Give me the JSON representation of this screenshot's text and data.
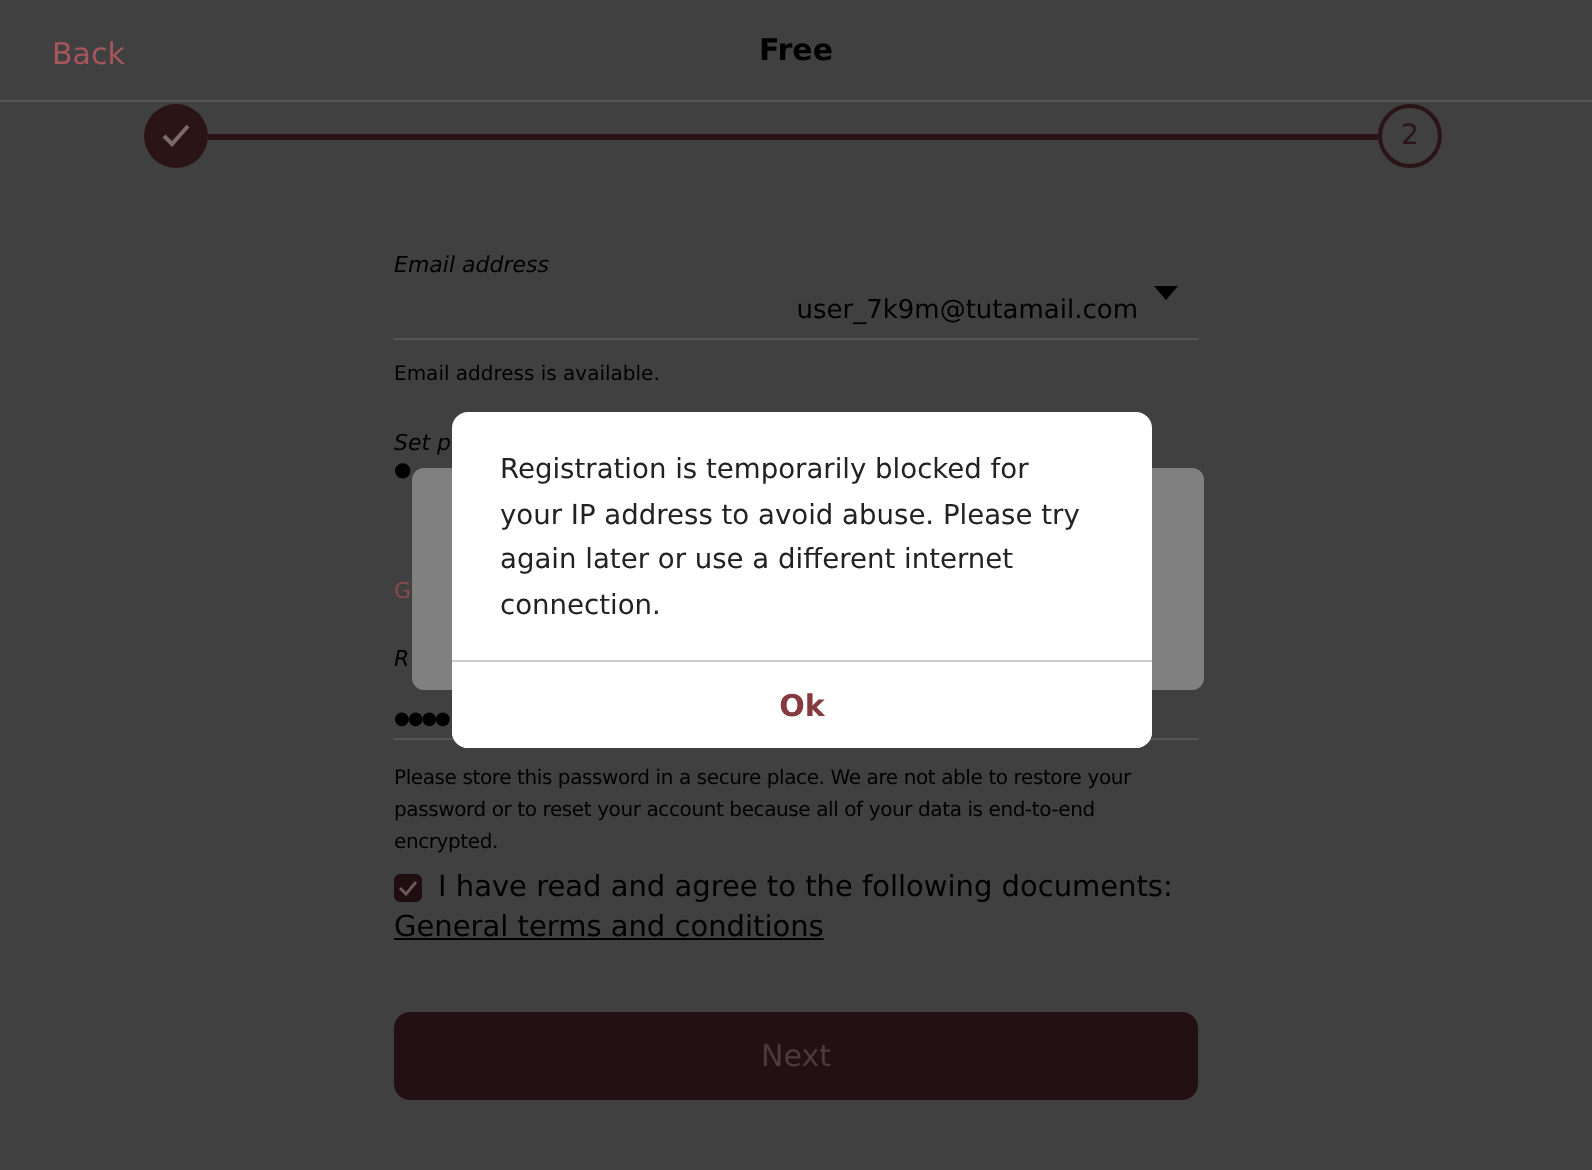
{
  "header": {
    "back": "Back",
    "title": "Free"
  },
  "steps": [
    {
      "kind": "done"
    },
    {
      "kind": "number",
      "label": "2"
    }
  ],
  "email": {
    "label": "Email address",
    "value": "user_7k9m@tutamail.com",
    "help": "Email address is available."
  },
  "password": {
    "label": "Set p",
    "mask": "●",
    "strength": "G"
  },
  "repeat": {
    "label": "R",
    "mask": "●●●●"
  },
  "notice": "Please store this password in a secure place. We are not able to restore your password or to reset your account because all of your data is end-to-end encrypted.",
  "agree": {
    "checked": true,
    "label": "I have read and agree to the following documents:",
    "link": "General terms and conditions"
  },
  "next_button": "Next",
  "dialog": {
    "message": "Registration is temporarily blocked for your IP address to avoid abuse. Please try again later or use a different internet connection.",
    "button": "Ok"
  }
}
